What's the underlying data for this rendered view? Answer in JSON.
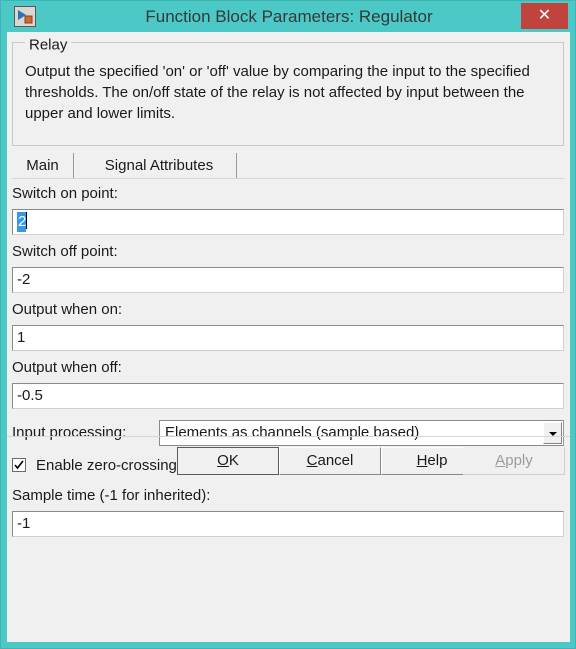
{
  "window": {
    "title": "Function Block Parameters: Regulator",
    "icon": "simulink-block-icon",
    "close_label": "✕",
    "frame_color": "#4cc8c6",
    "close_color": "#c1433e",
    "client_color": "#f0f0f0"
  },
  "group": {
    "label": "Relay",
    "description": "Output the specified 'on' or 'off' value by comparing the input to the specified thresholds.  The on/off state of the relay is not affected by input between the upper and lower limits."
  },
  "tabs": [
    {
      "label": "Main",
      "active": true
    },
    {
      "label": "Signal Attributes",
      "active": false
    }
  ],
  "fields": [
    {
      "label": "Switch on point:",
      "value": "2",
      "selected": true
    },
    {
      "label": "Switch off point:",
      "value": "-2",
      "selected": false
    },
    {
      "label": "Output when on:",
      "value": "1",
      "selected": false
    },
    {
      "label": "Output when off:",
      "value": "-0.5",
      "selected": false
    }
  ],
  "input_processing": {
    "label": "Input processing:",
    "value": "Elements as channels (sample based)",
    "arrow_icon": "chevron-down-icon"
  },
  "zero_crossing": {
    "label": "Enable zero-crossing detection",
    "checked": true,
    "check_icon": "checkmark-icon"
  },
  "sample_time": {
    "label": "Sample time (-1 for inherited):",
    "value": "-1"
  },
  "buttons": [
    {
      "name": "ok",
      "label": "OK",
      "mnemonic": "O",
      "rest": "K",
      "pre": "",
      "default": true,
      "disabled": false
    },
    {
      "name": "cancel",
      "label": "Cancel",
      "mnemonic": "C",
      "rest": "ancel",
      "pre": "",
      "default": false,
      "disabled": false
    },
    {
      "name": "help",
      "label": "Help",
      "mnemonic": "H",
      "rest": "elp",
      "pre": "",
      "default": false,
      "disabled": false
    },
    {
      "name": "apply",
      "label": "Apply",
      "mnemonic": "A",
      "rest": "pply",
      "pre": "",
      "default": false,
      "disabled": true
    }
  ],
  "colors": {
    "selection": "#3399e8",
    "text": "#1a1a1a",
    "disabled_text": "#9c9c9c"
  }
}
